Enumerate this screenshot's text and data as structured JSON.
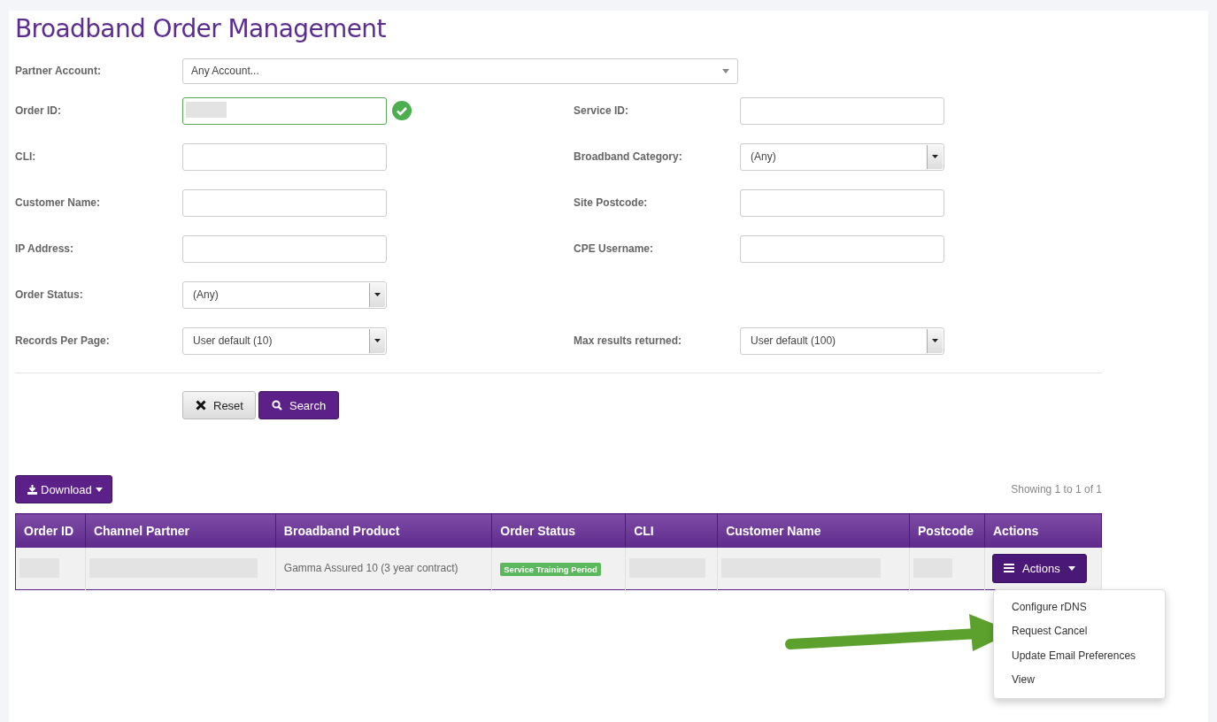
{
  "title": "Broadband Order Management",
  "partner_account": {
    "label": "Partner Account:",
    "value": "Any Account..."
  },
  "form_rows": [
    {
      "left": {
        "label": "Order ID:",
        "kind": "text",
        "redacted": true,
        "valid": true
      },
      "right": {
        "label": "Service ID:",
        "kind": "text",
        "redacted": false,
        "valid": false
      }
    },
    {
      "left": {
        "label": "CLI:",
        "kind": "text",
        "redacted": false,
        "valid": false
      },
      "right": {
        "label": "Broadband Category:",
        "kind": "select",
        "value": "(Any)"
      }
    },
    {
      "left": {
        "label": "Customer Name:",
        "kind": "text",
        "redacted": false,
        "valid": false
      },
      "right": {
        "label": "Site Postcode:",
        "kind": "text",
        "redacted": false,
        "valid": false
      }
    },
    {
      "left": {
        "label": "IP Address:",
        "kind": "text",
        "redacted": false,
        "valid": false
      },
      "right": {
        "label": "CPE Username:",
        "kind": "text",
        "redacted": false,
        "valid": false
      }
    },
    {
      "left": {
        "label": "Order Status:",
        "kind": "select",
        "value": "(Any)"
      }
    },
    {
      "left": {
        "label": "Records Per Page:",
        "kind": "select",
        "value": "User default (10)"
      },
      "right": {
        "label": "Max results returned:",
        "kind": "select",
        "value": "User default (100)"
      }
    }
  ],
  "buttons": {
    "reset": "Reset",
    "search": "Search"
  },
  "download_button": "Download",
  "showing": "Showing 1 to 1 of 1",
  "table": {
    "columns": [
      "Order ID",
      "Channel Partner",
      "Broadband Product",
      "Order Status",
      "CLI",
      "Customer Name",
      "Postcode",
      "Actions"
    ],
    "rows": [
      {
        "order_id": {
          "redacted": true
        },
        "channel_partner": {
          "redacted": true
        },
        "product": "Gamma Assured 10 (3 year contract)",
        "status": {
          "text": "Service Training Period",
          "color": "#5cb85c"
        },
        "cli": {
          "redacted": true
        },
        "customer_name": {
          "redacted": true
        },
        "postcode": {
          "redacted": true
        },
        "actions": "Actions"
      }
    ]
  },
  "actions_menu": {
    "open": true,
    "items": [
      "Configure rDNS",
      "Request Cancel",
      "Update Email Preferences",
      "View"
    ]
  }
}
